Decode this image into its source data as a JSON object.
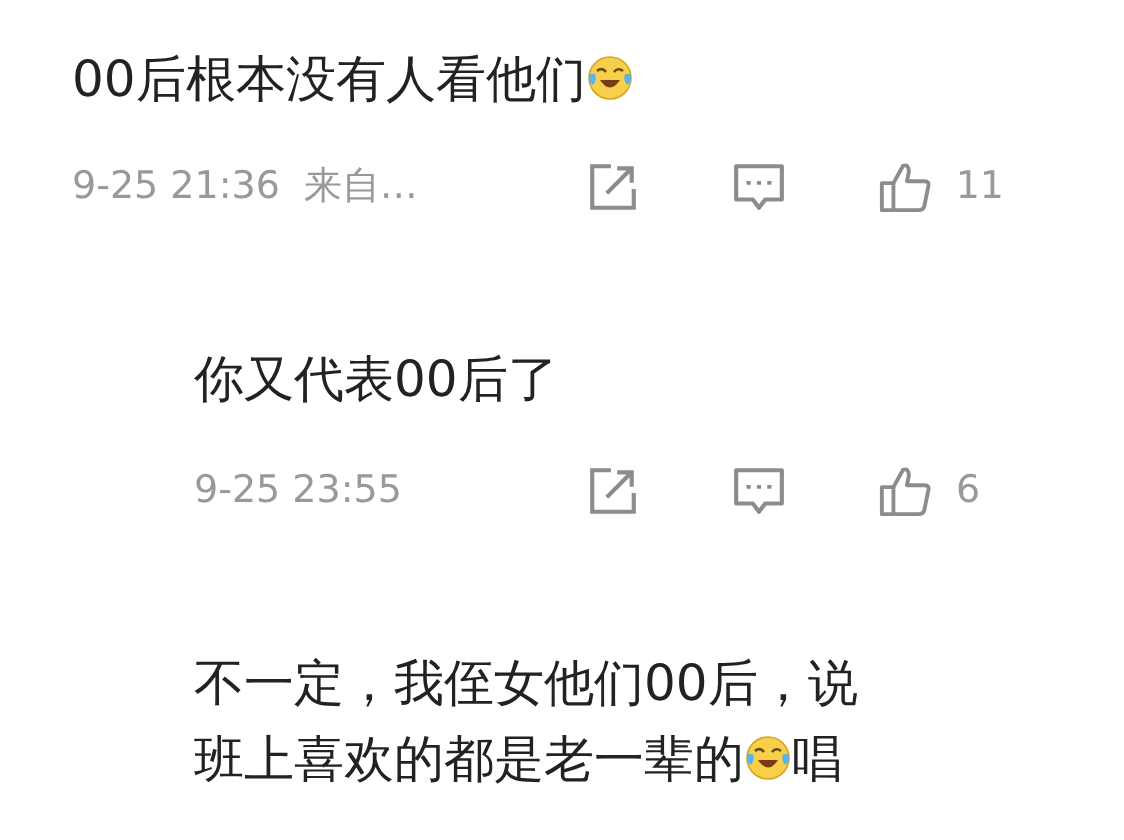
{
  "comments": [
    {
      "reply": false,
      "lines": [
        [
          {
            "kind": "text",
            "text": "00后根本没有人看他们"
          },
          {
            "kind": "emoji"
          }
        ]
      ],
      "time": "9-25 21:36",
      "source": "来自…",
      "likes": "11"
    },
    {
      "reply": true,
      "lines": [
        [
          {
            "kind": "text",
            "text": "你又代表00后了"
          }
        ]
      ],
      "time": "9-25 23:55",
      "likes": "6"
    },
    {
      "reply": true,
      "lines": [
        [
          {
            "kind": "text",
            "text": "不一定，我侄女他们00后，说"
          }
        ],
        [
          {
            "kind": "text",
            "text": "班上喜欢的都是老一辈的"
          },
          {
            "kind": "emoji"
          },
          {
            "kind": "text",
            "text": "唱"
          }
        ]
      ]
    }
  ]
}
